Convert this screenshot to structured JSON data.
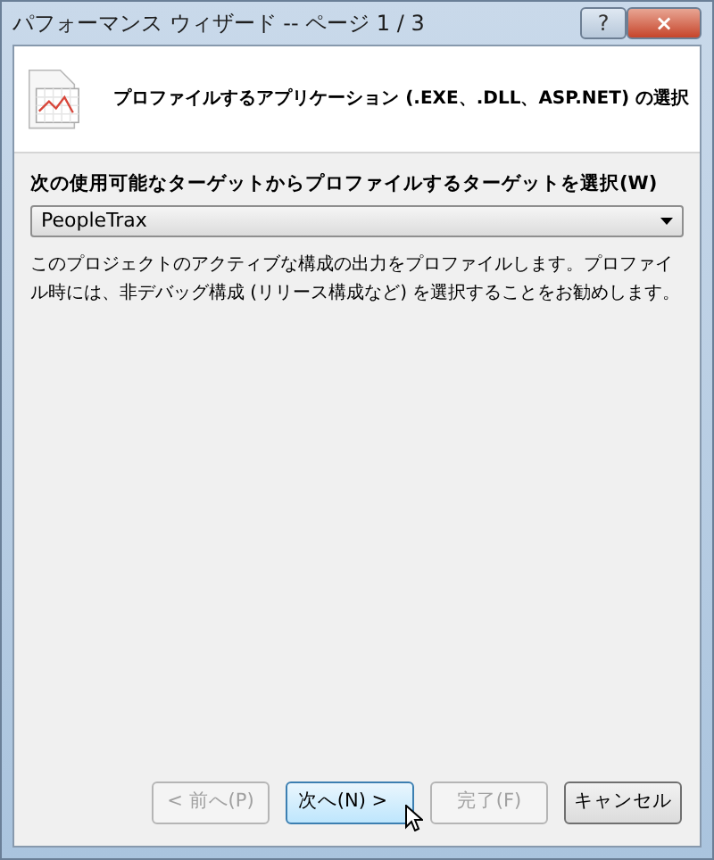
{
  "window": {
    "title": "パフォーマンス ウィザード -- ページ 1 / 3",
    "controls": [
      {
        "kind": "help",
        "label": "?"
      },
      {
        "kind": "close",
        "label": "×"
      }
    ]
  },
  "header": {
    "title": "プロファイルするアプリケーション (.EXE、.DLL、ASP.NET) の選択"
  },
  "target": {
    "label": "次の使用可能なターゲットからプロファイルするターゲットを選択(W)",
    "value": "PeopleTrax"
  },
  "description": "このプロジェクトのアクティブな構成の出力をプロファイルします。プロファイル時には、非デバッグ構成 (リリース構成など) を選択することをお勧めします。",
  "buttons": [
    {
      "label": "< 前へ(P)",
      "disabled": true,
      "hovered": false
    },
    {
      "label": "次へ(N) >",
      "disabled": false,
      "hovered": true
    },
    {
      "label": "完了(F)",
      "disabled": true,
      "hovered": false
    },
    {
      "label": "キャンセル",
      "disabled": false,
      "hovered": false
    }
  ]
}
